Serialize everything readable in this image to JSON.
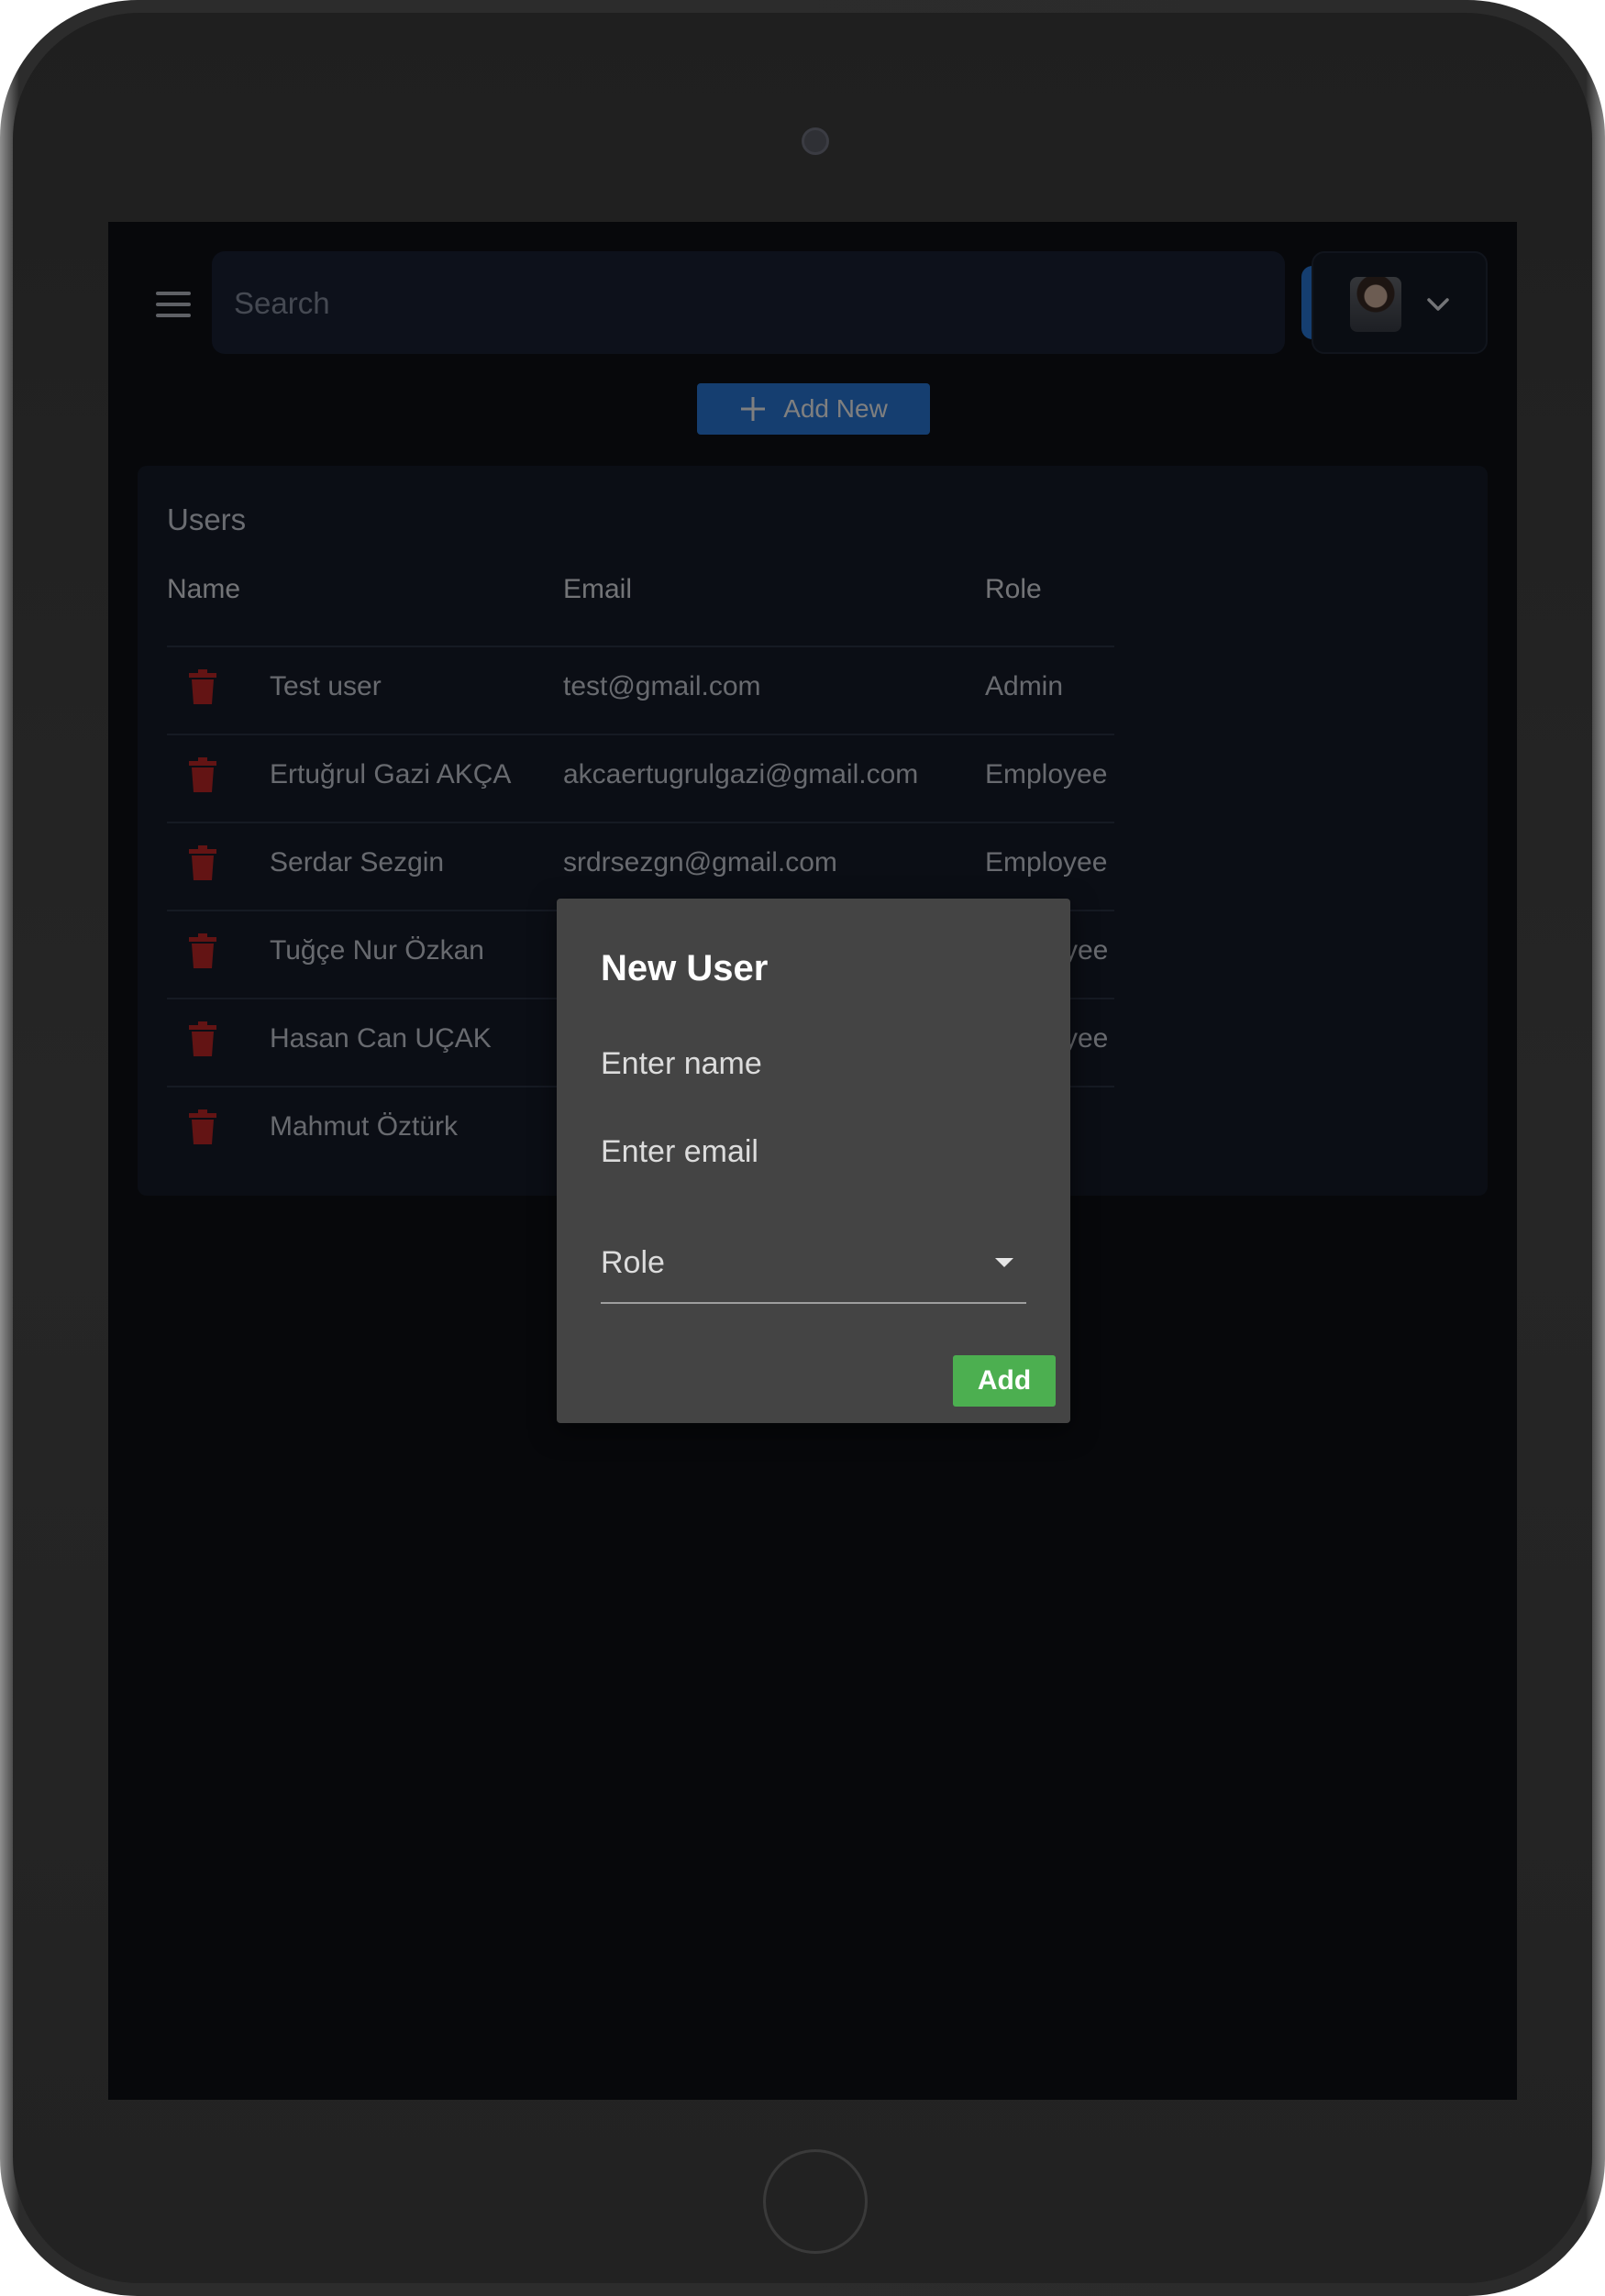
{
  "header": {
    "search_placeholder": "Search"
  },
  "toolbar": {
    "add_new_label": "Add New"
  },
  "users_card": {
    "title": "Users",
    "columns": [
      "Name",
      "Email",
      "Role"
    ],
    "rows": [
      {
        "name": "Test user",
        "email": "test@gmail.com",
        "role": "Admin"
      },
      {
        "name": "Ertuğrul Gazi AKÇA",
        "email": "akcaertugrulgazi@gmail.com",
        "role": "Employee"
      },
      {
        "name": "Serdar Sezgin",
        "email": "srdrsezgn@gmail.com",
        "role": "Employee"
      },
      {
        "name": "Tuğçe Nur Özkan",
        "email": "",
        "role": "yee"
      },
      {
        "name": "Hasan Can UÇAK",
        "email": "",
        "role": "yee"
      },
      {
        "name": "Mahmut Öztürk",
        "email": "",
        "role": ""
      }
    ]
  },
  "dialog": {
    "title": "New User",
    "name_placeholder": "Enter name",
    "email_placeholder": "Enter email",
    "role_label": "Role",
    "submit_label": "Add"
  },
  "colors": {
    "accent": "#2a7de1",
    "danger": "#c62828",
    "success": "#4caf50",
    "dialog_bg": "#444444"
  },
  "icons": {
    "menu": "hamburger-icon",
    "search": "search-icon",
    "dropdown": "chevron-down-icon",
    "add": "plus-icon",
    "delete": "trash-icon"
  }
}
